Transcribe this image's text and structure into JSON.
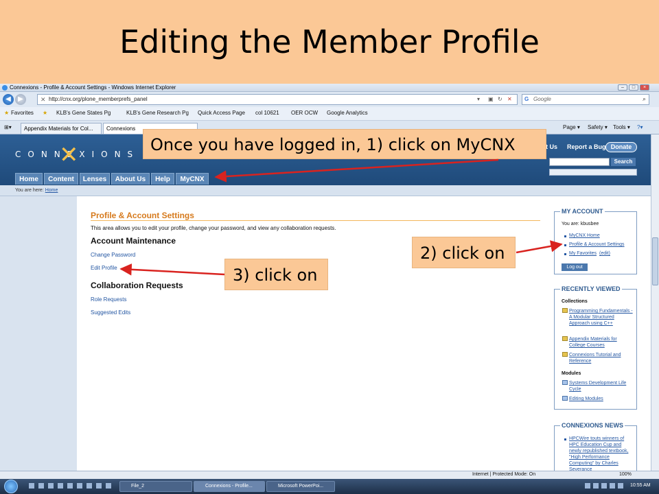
{
  "slide": {
    "title": "Editing the Member Profile"
  },
  "browser": {
    "window_title": "Connexions - Profile & Account Settings - Windows Internet Explorer",
    "url": "http://cnx.org/plone_memberprefs_panel",
    "search_placeholder": "Google",
    "favorites": [
      "Favorites",
      "KLB's Gene States Pg",
      "KLB's Gene Research Pg",
      "Quick Access Page",
      "col 10621",
      "OER OCW",
      "Google Analytics"
    ],
    "tabs": [
      "Appendix Materials for Col...",
      "Connexions"
    ],
    "tools": [
      "Page ▾",
      "Safety ▾",
      "Tools ▾",
      "?▾"
    ]
  },
  "site": {
    "logo": "CONNEXIONS",
    "nav": [
      "Home",
      "Content",
      "Lenses",
      "About Us",
      "Help",
      "MyCNX"
    ],
    "header_links": [
      "ct Us",
      "Report a Bug"
    ],
    "donate": "Donate",
    "search_button": "Search",
    "breadcrumb_prefix": "You are here:",
    "breadcrumb_link": "Home"
  },
  "main": {
    "heading": "Profile & Account Settings",
    "intro": "This area allows you to edit your profile, change your password, and view any collaboration requests.",
    "account_title": "Account Maintenance",
    "change_password": "Change Password",
    "edit_profile": "Edit Profile",
    "collab_title": "Collaboration Requests",
    "role_requests": "Role Requests",
    "suggested_edits": "Suggested Edits"
  },
  "sidebar": {
    "my_account": {
      "title": "MY ACCOUNT",
      "you_are": "You are: kbusbee",
      "links": [
        "MyCNX Home",
        "Profile & Account Settings",
        "My Favorites"
      ],
      "edit": "(edit)",
      "logout": "Log out"
    },
    "recently_viewed": {
      "title": "RECENTLY VIEWED",
      "collections_label": "Collections",
      "collections": [
        "Programming Fundamentals - A Modular Structured Approach using C++",
        "Appendix Materials for College Courses",
        "Connexions Tutorial and Reference"
      ],
      "modules_label": "Modules",
      "modules": [
        "Systems Development Life Cycle",
        "Editing Modules"
      ]
    },
    "news": {
      "title": "CONNEXIONS NEWS",
      "item": "HPCWire touts winners of HPC Education Cup and newly republished textbook, \"High Performance Computing\" by Charles Severance"
    }
  },
  "callouts": {
    "step1": "Once you have logged in, 1) click on MyCNX",
    "step2": "2) click on",
    "step3": "3) click on"
  },
  "status": {
    "zone": "Internet | Protected Mode: On",
    "zoom": "100%"
  },
  "taskbar": {
    "buttons": [
      "File_2",
      "Connexions - Profile...",
      "Microsoft PowerPoi..."
    ],
    "clock": "10:55 AM"
  },
  "colors": {
    "slide_band": "#fbc896",
    "header_blue": "#2d5f95",
    "heading_orange": "#d67a1d",
    "arrow_red": "#d9231f"
  }
}
